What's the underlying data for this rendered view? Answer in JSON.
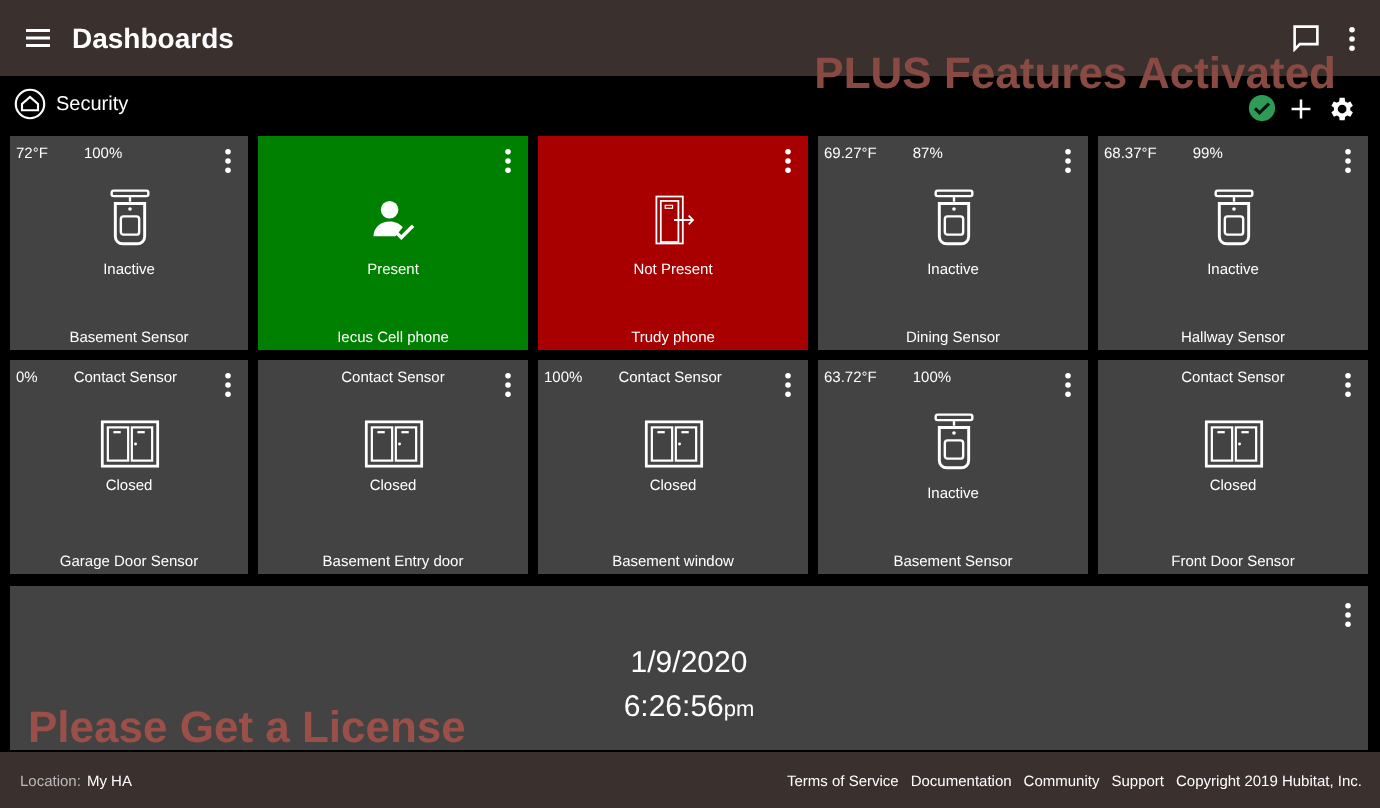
{
  "header": {
    "title": "Dashboards"
  },
  "dashboard": {
    "name": "Security",
    "status_ok": true
  },
  "overlays": [
    "PLUS Features Activated",
    "Please Get a License"
  ],
  "tiles": [
    {
      "kind": "motion",
      "readings": [
        "72°F",
        "100%"
      ],
      "state": "Inactive",
      "name": "Basement Sensor"
    },
    {
      "kind": "presence",
      "present": true,
      "state": "Present",
      "name": "Iecus Cell phone"
    },
    {
      "kind": "presence",
      "present": false,
      "state": "Not Present",
      "name": "Trudy phone"
    },
    {
      "kind": "motion",
      "readings": [
        "69.27°F",
        "87%"
      ],
      "state": "Inactive",
      "name": "Dining Sensor"
    },
    {
      "kind": "motion",
      "readings": [
        "68.37°F",
        "99%"
      ],
      "state": "Inactive",
      "name": "Hallway Sensor"
    },
    {
      "kind": "contact",
      "readings": [
        "0%",
        "Contact Sensor"
      ],
      "state": "Closed",
      "name": "Garage Door Sensor"
    },
    {
      "kind": "contact",
      "readings": [
        "Contact Sensor"
      ],
      "state": "Closed",
      "name": "Basement Entry door"
    },
    {
      "kind": "contact",
      "readings": [
        "100%",
        "Contact Sensor"
      ],
      "state": "Closed",
      "name": "Basement window"
    },
    {
      "kind": "motion",
      "readings": [
        "63.72°F",
        "100%"
      ],
      "state": "Inactive",
      "name": "Basement Sensor"
    },
    {
      "kind": "contact",
      "readings": [
        "Contact Sensor"
      ],
      "state": "Closed",
      "name": "Front Door Sensor"
    }
  ],
  "clock": {
    "date": "1/9/2020",
    "time": "6:26:56",
    "ampm": "pm"
  },
  "footer": {
    "location_label": "Location:",
    "location": "My HA",
    "links": [
      "Terms of Service",
      "Documentation",
      "Community",
      "Support"
    ],
    "copyright": "Copyright 2019 Hubitat, Inc."
  }
}
